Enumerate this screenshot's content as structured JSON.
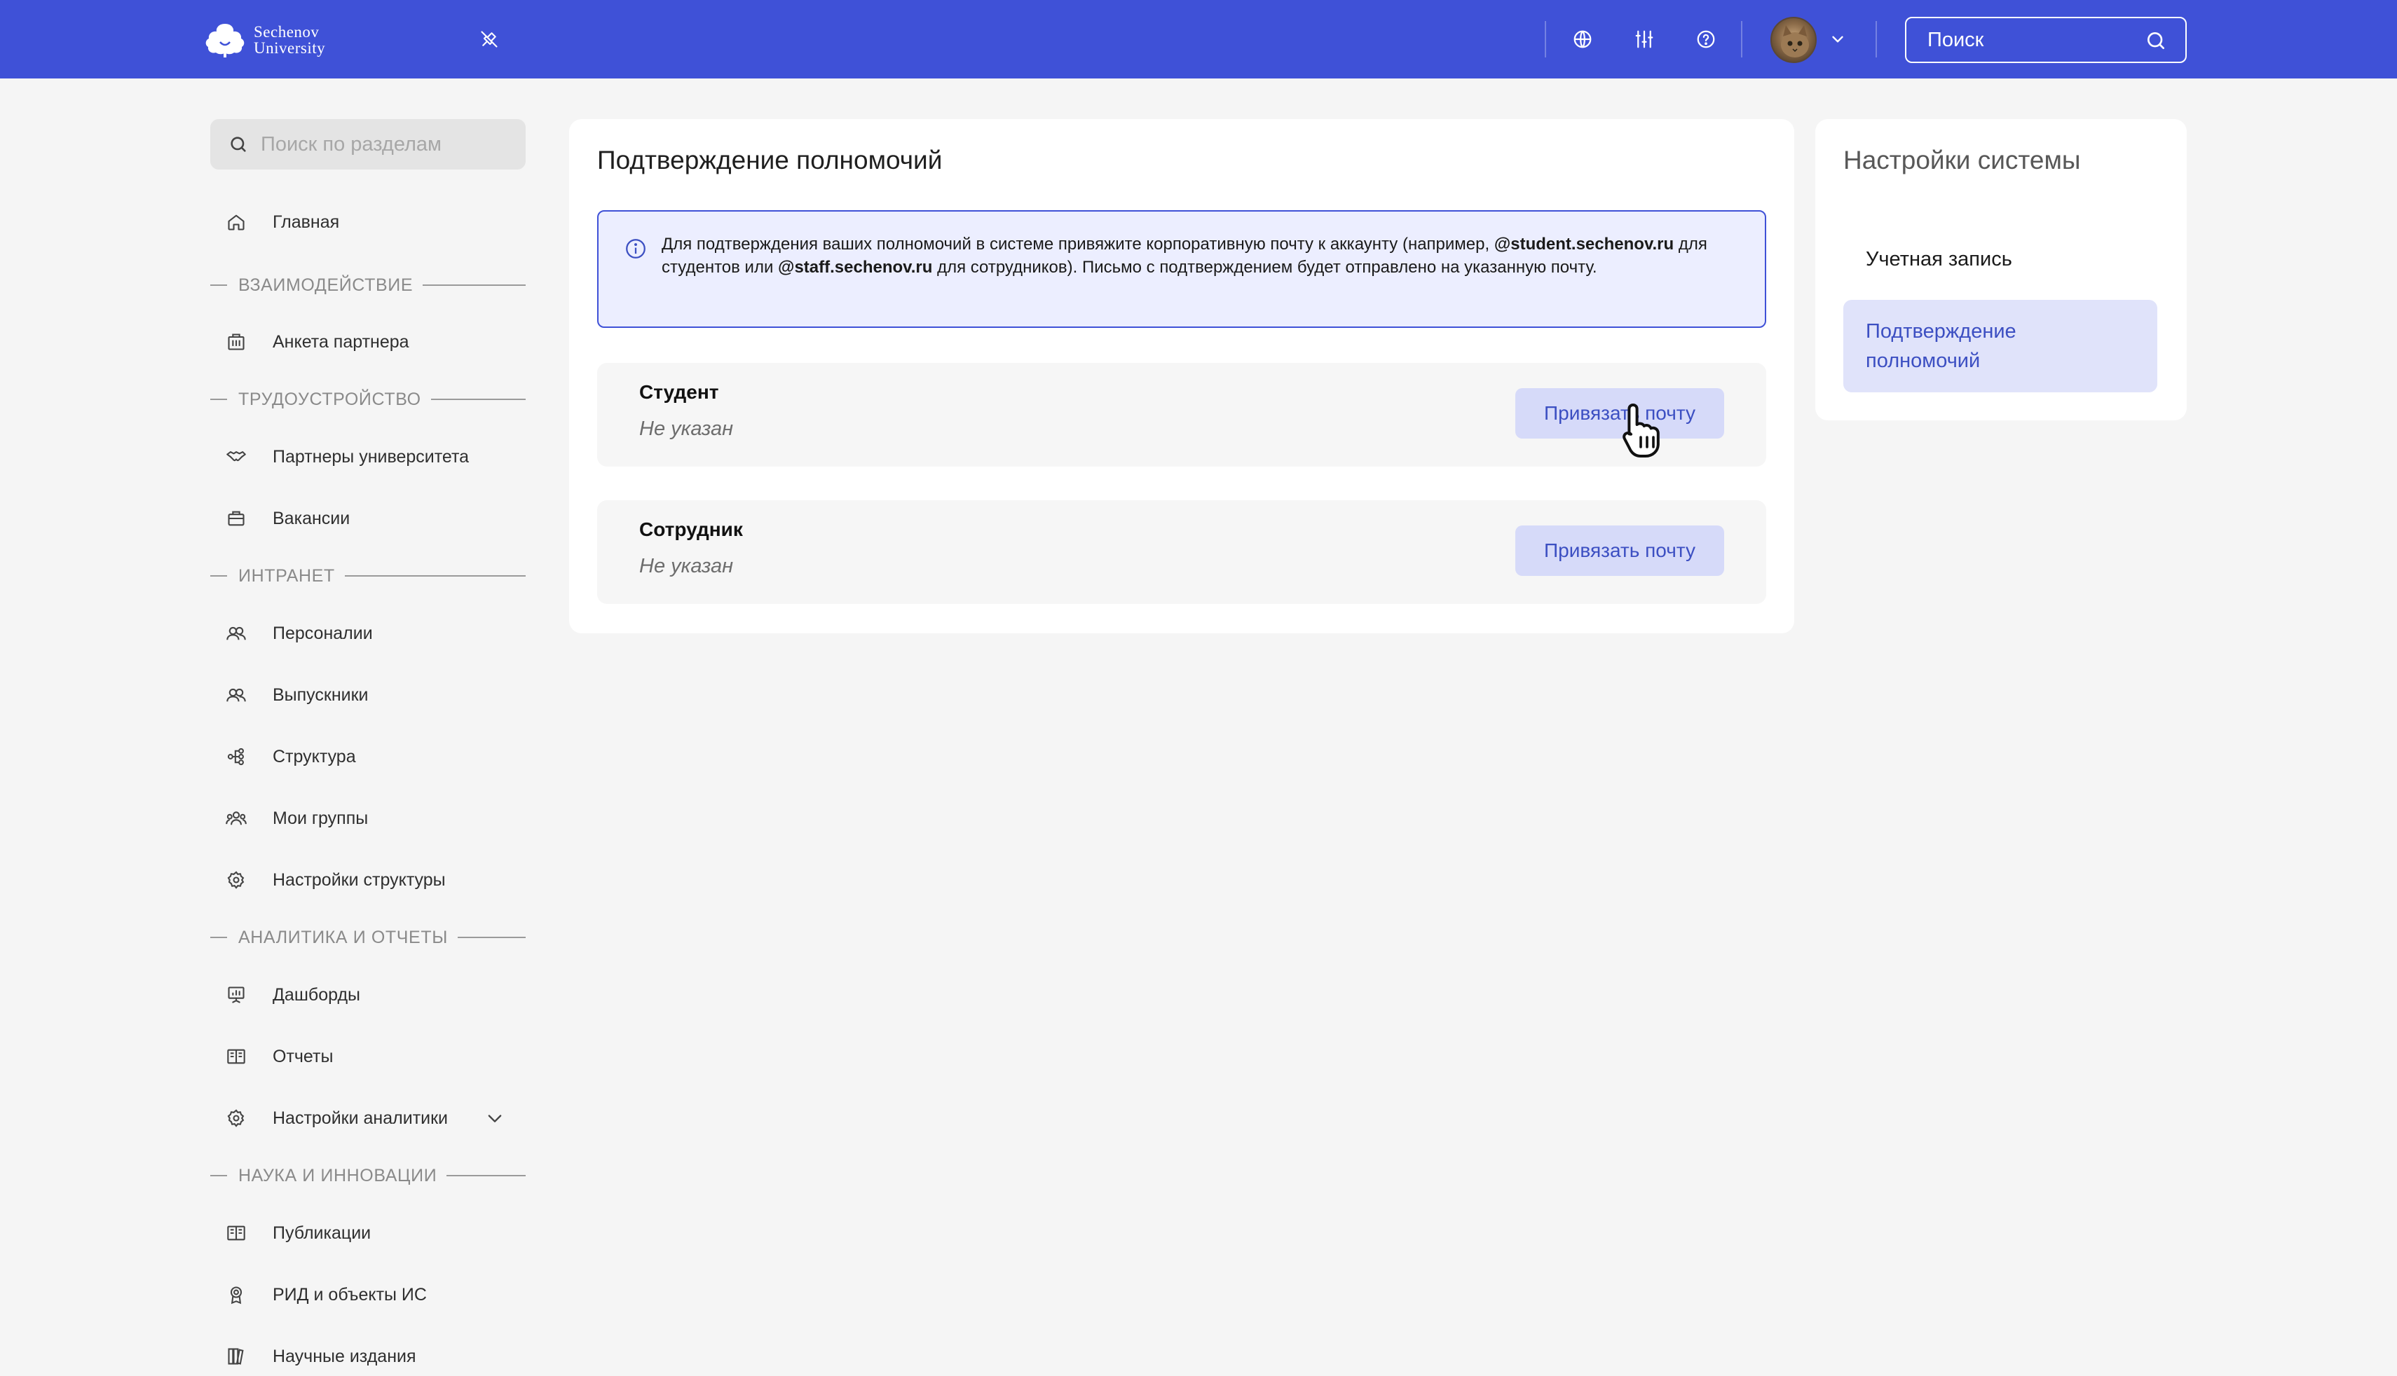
{
  "header": {
    "logo_line1": "Sechenov",
    "logo_line2": "University",
    "search_placeholder": "Поиск",
    "icons": [
      "pin-off-icon",
      "globe-icon",
      "sliders-icon",
      "help-icon",
      "avatar",
      "chevron-down-icon",
      "search-icon"
    ]
  },
  "sidebar": {
    "search_placeholder": "Поиск по разделам",
    "home": "Главная",
    "sections": {
      "interaction": "ВЗАИМОДЕЙСТВИЕ",
      "employment": "ТРУДОУСТРОЙСТВО",
      "intranet": "ИНТРАНЕТ",
      "analytics": "АНАЛИТИКА И ОТЧЕТЫ",
      "science": "НАУКА И ИННОВАЦИИ"
    },
    "items": {
      "partner_form": "Анкета партнера",
      "partners": "Партнеры университета",
      "vacancies": "Вакансии",
      "persons": "Персоналии",
      "graduates": "Выпускники",
      "structure": "Структура",
      "my_groups": "Мои группы",
      "structure_settings": "Настройки структуры",
      "dashboards": "Дашборды",
      "reports": "Отчеты",
      "analytics_settings": "Настройки аналитики",
      "publications": "Публикации",
      "rid": "РИД и объекты ИС",
      "journals": "Научные издания"
    }
  },
  "main": {
    "title": "Подтверждение полномочий",
    "info": {
      "part1": "Для подтверждения ваших полномочий в системе привяжите корпоративную почту к аккаунту (например, ",
      "student_domain": "@student.sechenov.ru",
      "part2": " для студентов или ",
      "staff_domain": "@staff.sechenov.ru",
      "part3": " для сотрудников). Письмо с подтверждением будет отправлено на указанную почту."
    },
    "roles": [
      {
        "name": "Студент",
        "status": "Не указан",
        "button": "Привязать почту"
      },
      {
        "name": "Сотрудник",
        "status": "Не указан",
        "button": "Привязать почту"
      }
    ]
  },
  "settings_panel": {
    "title": "Настройки системы",
    "items": [
      {
        "label": "Учетная запись",
        "active": false
      },
      {
        "label": "Подтверждение полномочий",
        "active": true
      }
    ]
  },
  "colors": {
    "header_bg": "#3f51d7",
    "accent": "#3c4fc2",
    "button_bg": "#d6daf9",
    "active_item_bg": "#e0e3fa",
    "info_bg": "#eceeff"
  }
}
